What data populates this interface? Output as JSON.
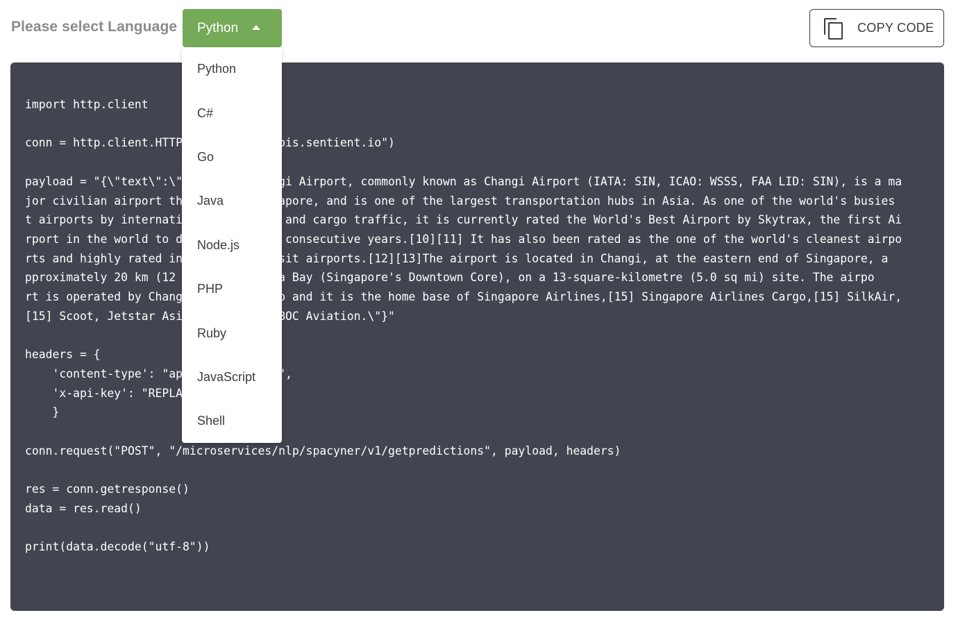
{
  "header": {
    "language_label": "Please select Language",
    "selected_language": "Python",
    "copy_label": "COPY CODE"
  },
  "dropdown": {
    "options": [
      "Python",
      "C#",
      "Go",
      "Java",
      "Node.js",
      "PHP",
      "Ruby",
      "JavaScript",
      "Shell"
    ]
  },
  "code": {
    "lines": [
      "import http.client",
      "",
      "conn = http.client.HTTPSConnection(\"apis.sentient.io\")",
      "",
      "payload = \"{\\\"text\\\":\\\"Singapore Changi Airport, commonly known as Changi Airport (IATA: SIN, ICAO: WSSS, FAA LID: SIN), is a ma",
      "jor civilian airport that serves Singapore, and is one of the largest transportation hubs in Asia. As one of the world's busies",
      "t airports by international passenger and cargo traffic, it is currently rated the World's Best Airport by Skytrax, the first Ai",
      "rport in the world to do so for eight consecutive years.[10][11] It has also been rated as the one of the world's cleanest airpo",
      "rts and highly rated in terms of transit airports.[12][13]The airport is located in Changi, at the eastern end of Singapore, a",
      "pproximately 20 km (12 mi) from Marina Bay (Singapore's Downtown Core), on a 13-square-kilometre (5.0 sq mi) site. The airpo",
      "rt is operated by Changi Airport Group and it is the home base of Singapore Airlines,[15] Singapore Airlines Cargo,[15] SilkAir,",
      "[15] Scoot, Jetstar Asia Airways and BOC Aviation.\\\"}\"",
      "",
      "headers = {",
      "    'content-type': \"application/json\",",
      "    'x-api-key': \"REPLACE_KEY_VALUE\"",
      "    }",
      "",
      "conn.request(\"POST\", \"/microservices/nlp/spacyner/v1/getpredictions\", payload, headers)",
      "",
      "res = conn.getresponse()",
      "data = res.read()",
      "",
      "print(data.decode(\"utf-8\"))"
    ]
  }
}
